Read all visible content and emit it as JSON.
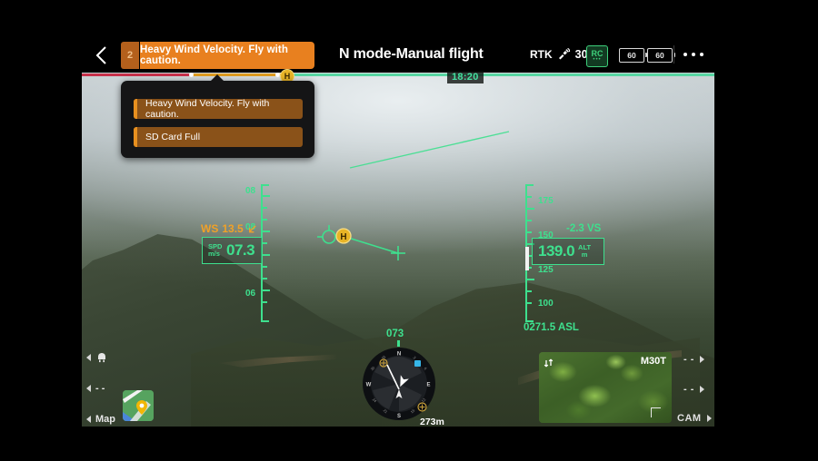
{
  "topbar": {
    "back_icon": "chevron-left-icon",
    "warning_count": "2",
    "warning_banner": "Heavy Wind Velocity. Fly with caution.",
    "mode_title": "N mode-Manual flight",
    "rtk_label": "RTK",
    "satellite_icon": "satellite-icon",
    "satellite_count": "30",
    "rc_badge": "RC",
    "battery_1": "60",
    "battery_2": "60",
    "more_icon": "more-horizontal-icon"
  },
  "timeline": {
    "time": "18:20",
    "home_marker": "H"
  },
  "warning_dropdown": {
    "items": [
      {
        "text": "Heavy Wind Velocity. Fly with caution."
      },
      {
        "text": "SD Card Full"
      }
    ]
  },
  "speed": {
    "wind_label": "WS",
    "wind_value": "13.5",
    "wind_arrow_icon": "arrow-down-left-icon",
    "spd_label": "SPD",
    "spd_unit": "m/s",
    "spd_value": "07.3",
    "ladder_ticks": [
      "08",
      "08",
      "06"
    ]
  },
  "altitude": {
    "vs_value": "-2.3 VS",
    "alt_value": "139.0",
    "alt_label": "ALT",
    "alt_unit": "m",
    "asl_value": "0271.5 ASL",
    "ladder_ticks": [
      "175",
      "150",
      "125",
      "100"
    ]
  },
  "compass": {
    "heading": "073",
    "distance": "273m",
    "cardinals": [
      "N",
      "E",
      "S",
      "W"
    ],
    "home_icon": "home-marker-icon",
    "drone_icon": "drone-marker-icon"
  },
  "bottom_left": {
    "gimbal_icon": "gimbal-icon",
    "gimbal_value": "",
    "dash_value": "- -",
    "map_label": "Map",
    "map_thumb_icon": "map-pin-icon"
  },
  "camera": {
    "swap_icon": "swap-camera-icon",
    "model": "M30T",
    "corner_icon": "focus-corner-icon",
    "side_items": [
      "- -",
      "- -",
      "CAM"
    ]
  },
  "colors": {
    "hud_green": "#3ee08e",
    "warn_orange": "#e8801f",
    "wind_orange": "#f0a128",
    "home_yellow": "#e8b426",
    "rc_green": "#3dcf7a"
  }
}
